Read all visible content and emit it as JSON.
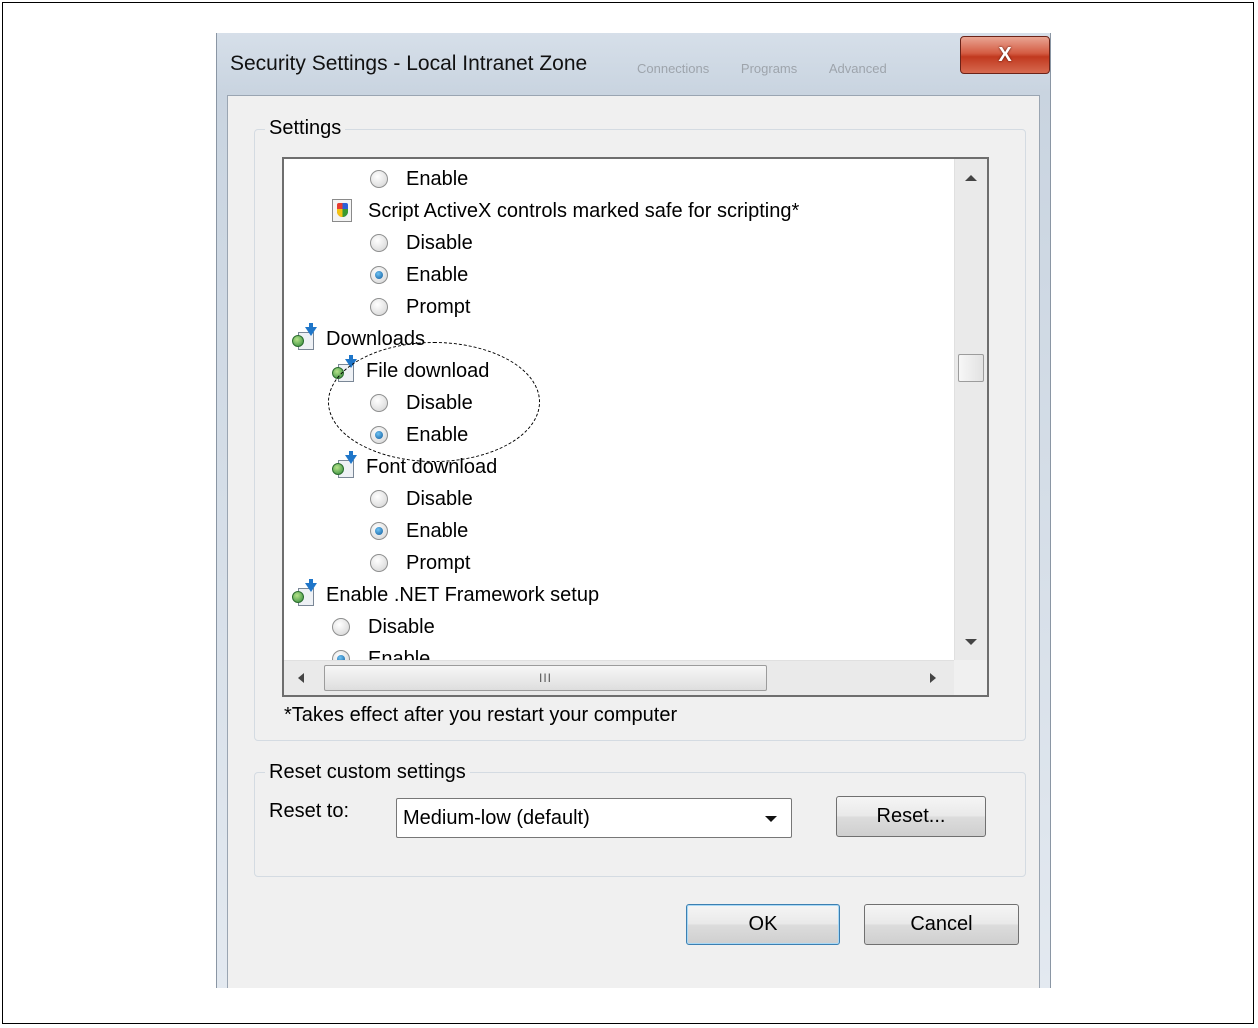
{
  "dialog": {
    "title": "Security Settings - Local Intranet Zone",
    "close_label": "X",
    "background_tabs": [
      "Connections",
      "Programs",
      "Advanced"
    ]
  },
  "settings_group": {
    "label": "Settings",
    "items": [
      {
        "type": "radio",
        "label": "Enable",
        "checked": false
      },
      {
        "type": "setting",
        "label": "Script ActiveX controls marked safe for scripting*",
        "icon": "shield-document-icon"
      },
      {
        "type": "radio",
        "label": "Disable",
        "checked": false
      },
      {
        "type": "radio",
        "label": "Enable",
        "checked": true
      },
      {
        "type": "radio",
        "label": "Prompt",
        "checked": false
      },
      {
        "type": "category",
        "label": "Downloads",
        "icon": "download-category-icon"
      },
      {
        "type": "setting",
        "label": "File download",
        "icon": "download-category-icon"
      },
      {
        "type": "radio",
        "label": "Disable",
        "checked": false
      },
      {
        "type": "radio",
        "label": "Enable",
        "checked": true
      },
      {
        "type": "setting",
        "label": "Font download",
        "icon": "download-category-icon"
      },
      {
        "type": "radio",
        "label": "Disable",
        "checked": false
      },
      {
        "type": "radio",
        "label": "Enable",
        "checked": true
      },
      {
        "type": "radio",
        "label": "Prompt",
        "checked": false
      },
      {
        "type": "category",
        "label": "Enable .NET Framework setup",
        "icon": "download-category-icon"
      },
      {
        "type": "radio",
        "label": "Disable",
        "checked": false
      },
      {
        "type": "radio",
        "label": "Enable",
        "checked": true
      }
    ],
    "hscroll_grip": "III",
    "footnote": "*Takes effect after you restart your computer"
  },
  "reset_group": {
    "label": "Reset custom settings",
    "reset_to_label": "Reset to:",
    "selected_level": "Medium-low (default)",
    "reset_button": "Reset..."
  },
  "buttons": {
    "ok": "OK",
    "cancel": "Cancel"
  },
  "colors": {
    "close_button": "#c1391f",
    "radio_selected": "#0f5a9c",
    "default_button_border": "#3c7fb1"
  }
}
